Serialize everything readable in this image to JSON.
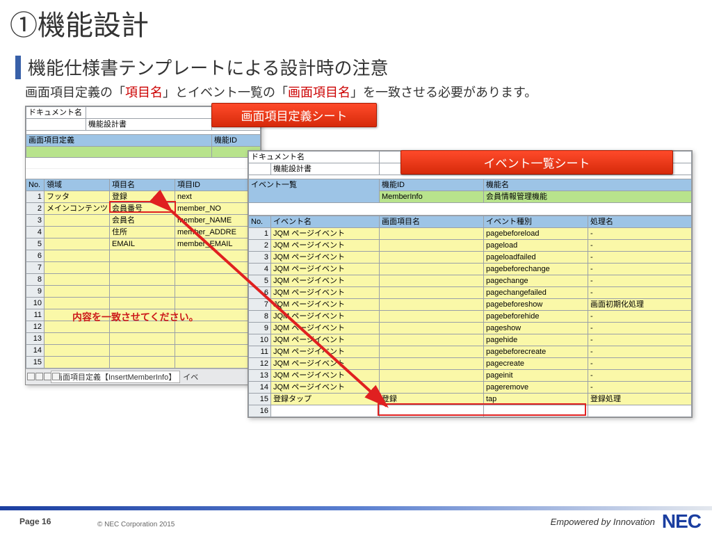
{
  "title": "①機能設計",
  "subtitle": "機能仕様書テンプレートによる設計時の注意",
  "desc_a": "画面項目定義の「",
  "desc_b": "項目名",
  "desc_c": "」とイベント一覧の「",
  "desc_d": "画面項目名",
  "desc_e": "」を一致させる必要があります。",
  "tag_left": "画面項目定義シート",
  "tag_right": "イベント一覧シート",
  "warn": "内容を一致させてください。",
  "left": {
    "doc_label": "ドキュメント名",
    "doc_value": "機能設計書",
    "section": "画面項目定義",
    "kinou_id": "機能ID",
    "th_no": "No.",
    "th_area": "領域",
    "th_item": "項目名",
    "th_itemid": "項目ID",
    "rows": [
      {
        "n": 1,
        "area": "フッタ",
        "item": "登録",
        "id": "next"
      },
      {
        "n": 2,
        "area": "メインコンテンツ",
        "item": "会員番号",
        "id": "member_NO"
      },
      {
        "n": 3,
        "area": "",
        "item": "会員名",
        "id": "member_NAME"
      },
      {
        "n": 4,
        "area": "",
        "item": "住所",
        "id": "member_ADDRE"
      },
      {
        "n": 5,
        "area": "",
        "item": "EMAIL",
        "id": "member_EMAIL"
      },
      {
        "n": 6,
        "area": "",
        "item": "",
        "id": ""
      },
      {
        "n": 7,
        "area": "",
        "item": "",
        "id": ""
      },
      {
        "n": 8,
        "area": "",
        "item": "",
        "id": ""
      },
      {
        "n": 9,
        "area": "",
        "item": "",
        "id": ""
      },
      {
        "n": 10,
        "area": "",
        "item": "",
        "id": ""
      },
      {
        "n": 11,
        "area": "",
        "item": "",
        "id": ""
      },
      {
        "n": 12,
        "area": "",
        "item": "",
        "id": ""
      },
      {
        "n": 13,
        "area": "",
        "item": "",
        "id": ""
      },
      {
        "n": 14,
        "area": "",
        "item": "",
        "id": ""
      },
      {
        "n": 15,
        "area": "",
        "item": "",
        "id": ""
      }
    ],
    "tab": "画面項目定義【InsertMemberInfo】",
    "tab_next": "イベ"
  },
  "right": {
    "doc_label": "ドキュメント名",
    "doc_value": "機能設計書",
    "kinou_id_label": "機能ID",
    "kinou_id": "MemberInfo",
    "kinou_name_label": "機能名",
    "kinou_name": "会員情報管理機能",
    "section": "イベント一覧",
    "th_no": "No.",
    "th_event": "イベント名",
    "th_screen": "画面項目名",
    "th_kind": "イベント種別",
    "th_proc": "処理名",
    "rows": [
      {
        "n": 1,
        "e": "JQM ページイベント",
        "s": "",
        "k": "pagebeforeload",
        "p": "-"
      },
      {
        "n": 2,
        "e": "JQM ページイベント",
        "s": "",
        "k": "pageload",
        "p": "-"
      },
      {
        "n": 3,
        "e": "JQM ページイベント",
        "s": "",
        "k": "pageloadfailed",
        "p": "-"
      },
      {
        "n": 4,
        "e": "JQM ページイベント",
        "s": "",
        "k": "pagebeforechange",
        "p": "-"
      },
      {
        "n": 5,
        "e": "JQM ページイベント",
        "s": "",
        "k": "pagechange",
        "p": "-"
      },
      {
        "n": 6,
        "e": "JQM ページイベント",
        "s": "",
        "k": "pagechangefailed",
        "p": "-"
      },
      {
        "n": 7,
        "e": "JQM ページイベント",
        "s": "",
        "k": "pagebeforeshow",
        "p": "画面初期化処理"
      },
      {
        "n": 8,
        "e": "JQM ページイベント",
        "s": "",
        "k": "pagebeforehide",
        "p": "-"
      },
      {
        "n": 9,
        "e": "JQM ページイベント",
        "s": "",
        "k": "pageshow",
        "p": "-"
      },
      {
        "n": 10,
        "e": "JQM ページイベント",
        "s": "",
        "k": "pagehide",
        "p": "-"
      },
      {
        "n": 11,
        "e": "JQM ページイベント",
        "s": "",
        "k": "pagebeforecreate",
        "p": "-"
      },
      {
        "n": 12,
        "e": "JQM ページイベント",
        "s": "",
        "k": "pagecreate",
        "p": "-"
      },
      {
        "n": 13,
        "e": "JQM ページイベント",
        "s": "",
        "k": "pageinit",
        "p": "-"
      },
      {
        "n": 14,
        "e": "JQM ページイベント",
        "s": "",
        "k": "pageremove",
        "p": "-"
      },
      {
        "n": 15,
        "e": "登録タップ",
        "s": "登録",
        "k": "tap",
        "p": "登録処理"
      },
      {
        "n": 16,
        "e": "",
        "s": "",
        "k": "",
        "p": ""
      }
    ]
  },
  "footer": {
    "page": "Page 16",
    "copy": "© NEC Corporation 2015",
    "tagline": "Empowered by Innovation",
    "brand": "NEC"
  }
}
